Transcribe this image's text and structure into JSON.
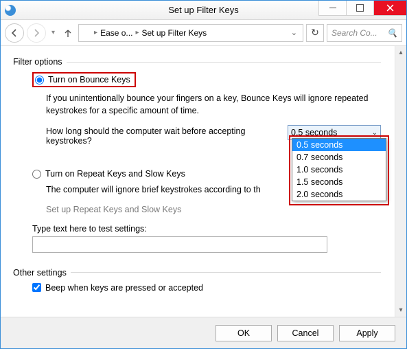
{
  "window": {
    "title": "Set up Filter Keys"
  },
  "breadcrumb": {
    "parent": "Ease o...",
    "current": "Set up Filter Keys"
  },
  "search": {
    "placeholder": "Search Co...",
    "icon": "magnify-icon"
  },
  "groups": {
    "filter_options": "Filter options",
    "other_settings": "Other settings"
  },
  "bounce": {
    "radio_label": "Turn on Bounce Keys",
    "description": "If you unintentionally bounce your fingers on a key, Bounce Keys will ignore repeated keystrokes for a specific amount of time.",
    "wait_question": "How long should the computer wait before accepting keystrokes?",
    "selected": "0.5 seconds",
    "options": [
      "0.5 seconds",
      "0.7 seconds",
      "1.0 seconds",
      "1.5 seconds",
      "2.0 seconds"
    ]
  },
  "repeat": {
    "radio_label": "Turn on Repeat Keys and Slow Keys",
    "description": "The computer will ignore brief keystrokes according to th",
    "link": "Set up Repeat Keys and Slow Keys"
  },
  "test": {
    "label": "Type text here to test settings:",
    "value": ""
  },
  "other": {
    "beep_label": "Beep when keys are pressed or accepted",
    "beep_checked": true
  },
  "buttons": {
    "ok": "OK",
    "cancel": "Cancel",
    "apply": "Apply"
  }
}
